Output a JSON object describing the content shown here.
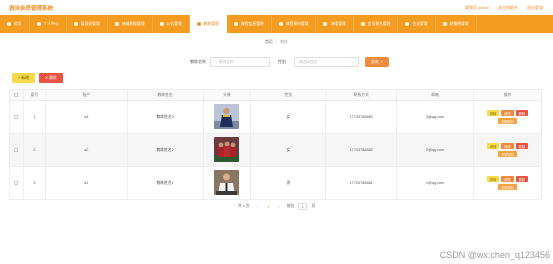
{
  "app": {
    "title": "游泳会员管理系统"
  },
  "top_links": [
    "管理员 admin",
    "退出到前台",
    "退出登录"
  ],
  "nav": [
    {
      "label": "首页",
      "active": false
    },
    {
      "label": "个人中心",
      "active": false
    },
    {
      "label": "管理员管理",
      "active": false
    },
    {
      "label": "基础数据管理",
      "active": false
    },
    {
      "label": "公告管理",
      "active": false
    },
    {
      "label": "教练管理",
      "active": true
    },
    {
      "label": "课程信息管理",
      "active": false
    },
    {
      "label": "课程预约管理",
      "active": false
    },
    {
      "label": "场馆管理",
      "active": false
    },
    {
      "label": "会员报名管理",
      "active": false
    },
    {
      "label": "会员管理",
      "active": false
    },
    {
      "label": "轮播图管理",
      "active": false
    }
  ],
  "breadcrumb": {
    "home": "首页",
    "separator": "/",
    "current": "教练"
  },
  "search": {
    "name_label": "教练名称",
    "name_placeholder": "教练名称",
    "gender_label": "性别",
    "gender_placeholder": "请选择性别",
    "button": "查询"
  },
  "actions": {
    "add": "+ 新增",
    "delete": "✕ 删除"
  },
  "table": {
    "headers": [
      "",
      "索引",
      "账户",
      "教练姓名",
      "头像",
      "性别",
      "联系方式",
      "邮箱",
      "操作"
    ],
    "rows": [
      {
        "index": "1",
        "account": "a3",
        "name": "教练姓名3",
        "gender": "女",
        "phone": "17703786883",
        "email": "3@qq.com",
        "photo": "photo-1"
      },
      {
        "index": "2",
        "account": "a2",
        "name": "教练姓名2",
        "gender": "女",
        "phone": "17703786882",
        "email": "2@qq.com",
        "photo": "photo-2"
      },
      {
        "index": "3",
        "account": "a1",
        "name": "教练姓名1",
        "gender": "男",
        "phone": "17703786881",
        "email": "1@qq.com",
        "photo": "photo-3"
      }
    ],
    "op_labels": {
      "detail": "详情",
      "edit": "修改",
      "delete": "删除",
      "reset": "重置密码"
    }
  },
  "pager": {
    "total": "共 1 页",
    "prev": "‹",
    "current": "1",
    "next": "›",
    "goto_label": "前往",
    "goto_value": "1",
    "page_suffix": "页"
  },
  "watermark": "CSDN @wx:chen_q123456",
  "colors": {
    "accent": "#f39c1f",
    "danger": "#e8543f",
    "warning": "#f7d94c"
  }
}
